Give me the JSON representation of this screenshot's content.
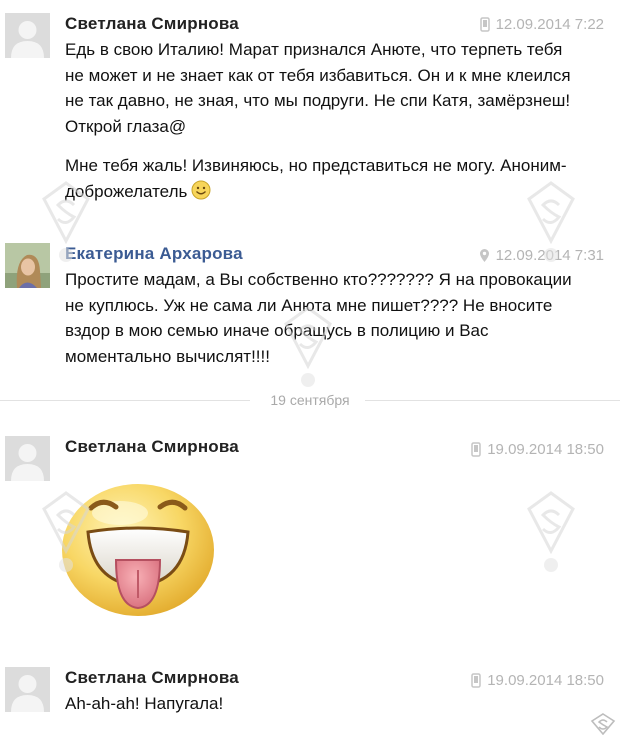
{
  "messages": [
    {
      "author": "Светлана Смирнова",
      "date": "12.09.2014 7:22",
      "device": "phone-icon",
      "paragraphs": [
        "Едь в свою Италию! Марат признался Анюте, что терпеть тебя не может и не знает как от тебя избавиться. Он и к мне клеился не так давно, не зная, что мы подруги. Не спи Катя, замёрзнеш! Открой глаза@",
        "Мне тебя жаль! Извиняюсь, но представиться не могу. Аноним-доброжелатель"
      ]
    },
    {
      "author": "Екатерина Архарова",
      "date": "12.09.2014 7:31",
      "device": "location-icon",
      "paragraphs": [
        "Простите мадам, а Вы собственно кто??????? Я на провокации не куплюсь. Уж не сама ли Анюта мне пишет???? Не вносите вздор в мою семью иначе обращусь в полицию и Вас моментально вычислят!!!!"
      ]
    },
    {
      "author": "Светлана Смирнова",
      "date": "19.09.2014 18:50",
      "device": "phone-icon",
      "sticker": "tongue-out-smiley"
    },
    {
      "author": "Светлана Смирнова",
      "date": "19.09.2014 18:50",
      "device": "phone-icon",
      "paragraphs": [
        "Ah-ah-ah! Напугала!"
      ]
    }
  ],
  "day_divider": "19 сентября",
  "watermark": "SUPER",
  "footer_logo": "SUPER.RU",
  "colors": {
    "author_blue": "#3b5b93",
    "meta_gray": "#b4b4b4",
    "divider": "#e2e2e2"
  }
}
